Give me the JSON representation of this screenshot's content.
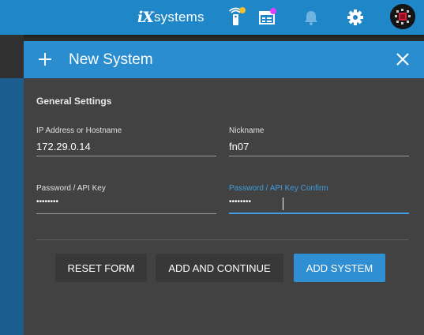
{
  "topbar": {
    "brand_mark": "iX",
    "brand_text": "systems",
    "icons": [
      "appliance-status-icon",
      "task-manager-icon",
      "notifications-icon",
      "settings-icon",
      "account-avatar-icon"
    ],
    "badge_colors": {
      "status": "#f5c026",
      "task": "#e040fb"
    }
  },
  "dialog": {
    "title": "New System",
    "section_title": "General Settings",
    "fields": {
      "host": {
        "label": "IP Address or Hostname",
        "value": "172.29.0.14"
      },
      "nickname": {
        "label": "Nickname",
        "value": "fn07"
      },
      "password": {
        "label": "Password / API Key",
        "value": "••••••••"
      },
      "password_confirm": {
        "label": "Password / API Key Confirm",
        "value": "••••••••"
      }
    },
    "buttons": {
      "reset": "RESET FORM",
      "add_continue": "ADD AND CONTINUE",
      "add_system": "ADD SYSTEM"
    }
  },
  "colors": {
    "topbar": "#1f86c8",
    "dialog_header": "#2a8dd0",
    "dialog_body": "#424242",
    "accent": "#3f9de0"
  }
}
